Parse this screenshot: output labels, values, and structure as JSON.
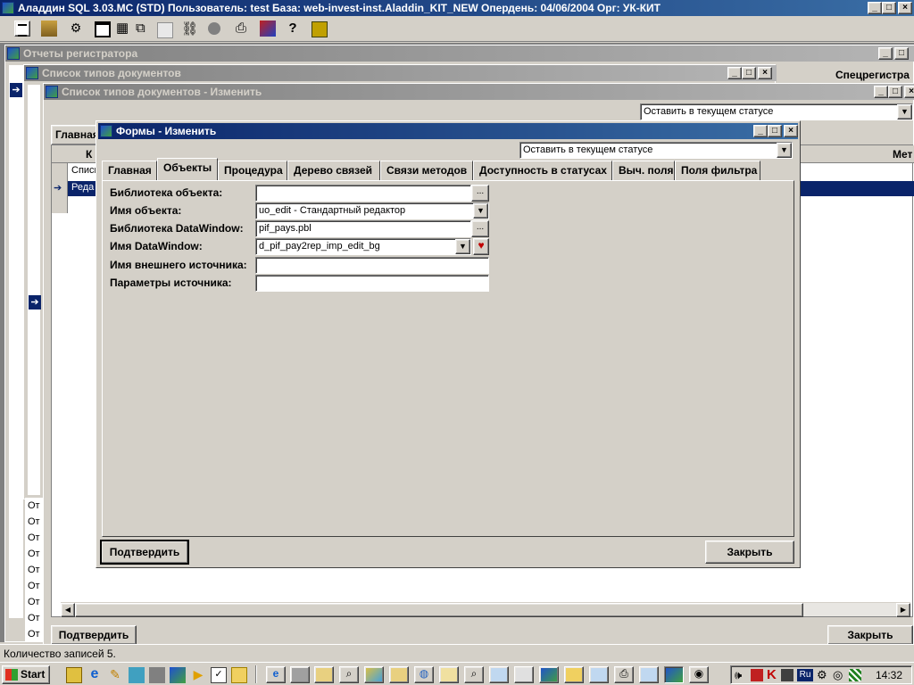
{
  "app": {
    "title": "Аладдин SQL 3.03.MC (STD)  Пользователь: test База: web-invest-inst.Aladdin_KIT_NEW Опердень: 04/06/2004 Орг: УК-КИТ",
    "min": "_",
    "max": "□",
    "close": "×"
  },
  "windows": {
    "registrar": {
      "title": "Отчеты регистратора",
      "col_right": "Спецрегистра"
    },
    "doc_types": {
      "title": "Список типов документов"
    },
    "doc_types_edit": {
      "title": "Список типов документов - Изменить",
      "status_select": "Оставить в текущем статусе"
    },
    "behind": {
      "tab_main": "Главная",
      "col_k": "К",
      "col_met": "Мет",
      "row1": "Списк",
      "row2": "Реда",
      "list_items": [
        "От",
        "От",
        "От",
        "От",
        "От",
        "От",
        "От",
        "От",
        "От"
      ],
      "confirm": "Подтвердить",
      "close": "Закрыть"
    }
  },
  "dialog": {
    "title": "Формы - Изменить",
    "status_select": "Оставить в текущем статусе",
    "tabs": [
      "Главная",
      "Объекты",
      "Процедура",
      "Дерево связей",
      "Связи методов",
      "Доступность в статусах",
      "Выч. поля",
      "Поля фильтра"
    ],
    "active_tab": 1,
    "fields": {
      "obj_library": {
        "label": "Библиотека объекта:",
        "value": ""
      },
      "obj_name": {
        "label": "Имя объекта:",
        "value": "uo_edit - Стандартный редактор"
      },
      "dw_library": {
        "label": "Библиотека DataWindow:",
        "value": "pif_pays.pbl"
      },
      "dw_name": {
        "label": "Имя DataWindow:",
        "value": "d_pif_pay2rep_imp_edit_bg"
      },
      "ext_source": {
        "label": "Имя внешнего источника:",
        "value": ""
      },
      "source_params": {
        "label": "Параметры источника:",
        "value": ""
      }
    },
    "ellipsis": "...",
    "confirm": "Подтвердить",
    "close": "Закрыть"
  },
  "statusbar": {
    "text": "Количество записей 5."
  },
  "taskbar": {
    "start": "Start",
    "clock": "14:32",
    "lang": "Ru"
  }
}
